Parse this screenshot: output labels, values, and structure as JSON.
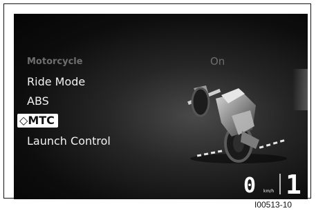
{
  "menu": {
    "header": "Motorcycle",
    "header_value": "On",
    "items": [
      {
        "label": "Ride Mode"
      },
      {
        "label": "ABS"
      },
      {
        "label": "MTC",
        "marker": "◇"
      },
      {
        "label": "Launch Control"
      }
    ]
  },
  "dashboard": {
    "speed": "0",
    "speed_unit": "km/h",
    "gear": "1"
  },
  "caption": "I00513-10",
  "colors": {
    "background": "#0d0d0d",
    "text": "#f2f2f2",
    "dim_text": "#6e6e6e",
    "highlight": "#ffffff"
  }
}
